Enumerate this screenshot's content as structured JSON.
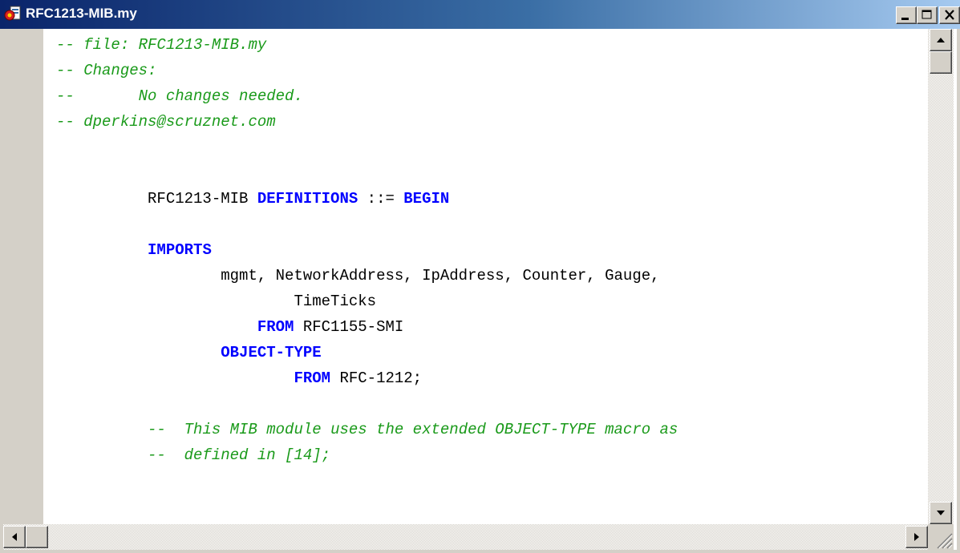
{
  "window": {
    "title": "RFC1213-MIB.my",
    "icon": "document-app-icon",
    "controls": [
      "minimize-icon",
      "maximize-icon",
      "close-icon"
    ]
  },
  "colors": {
    "comment": "#1a9a1a",
    "keyword": "#0000ff",
    "plain": "#000000",
    "titlebar_start": "#0a246a",
    "titlebar_end": "#a6caf0"
  },
  "editor": {
    "lines": [
      {
        "tokens": [
          {
            "type": "comment",
            "text": "-- file: RFC1213-MIB.my"
          }
        ]
      },
      {
        "tokens": [
          {
            "type": "comment",
            "text": "-- Changes:"
          }
        ]
      },
      {
        "tokens": [
          {
            "type": "comment",
            "text": "--       No changes needed."
          }
        ]
      },
      {
        "tokens": [
          {
            "type": "comment",
            "text": "-- dperkins@scruznet.com"
          }
        ]
      },
      {
        "tokens": []
      },
      {
        "tokens": []
      },
      {
        "tokens": [
          {
            "type": "plain",
            "text": "          RFC1213-MIB "
          },
          {
            "type": "keyword",
            "text": "DEFINITIONS"
          },
          {
            "type": "plain",
            "text": " ::= "
          },
          {
            "type": "keyword",
            "text": "BEGIN"
          }
        ]
      },
      {
        "tokens": []
      },
      {
        "tokens": [
          {
            "type": "plain",
            "text": "          "
          },
          {
            "type": "keyword",
            "text": "IMPORTS"
          }
        ]
      },
      {
        "tokens": [
          {
            "type": "plain",
            "text": "                  mgmt, NetworkAddress, IpAddress, Counter, Gauge,"
          }
        ]
      },
      {
        "tokens": [
          {
            "type": "plain",
            "text": "                          TimeTicks"
          }
        ]
      },
      {
        "tokens": [
          {
            "type": "plain",
            "text": "                      "
          },
          {
            "type": "keyword",
            "text": "FROM"
          },
          {
            "type": "plain",
            "text": " RFC1155-SMI"
          }
        ]
      },
      {
        "tokens": [
          {
            "type": "plain",
            "text": "                  "
          },
          {
            "type": "keyword",
            "text": "OBJECT-TYPE"
          }
        ]
      },
      {
        "tokens": [
          {
            "type": "plain",
            "text": "                          "
          },
          {
            "type": "keyword",
            "text": "FROM"
          },
          {
            "type": "plain",
            "text": " RFC-1212;"
          }
        ]
      },
      {
        "tokens": []
      },
      {
        "tokens": [
          {
            "type": "plain",
            "text": "          "
          },
          {
            "type": "comment",
            "text": "--  This MIB module uses the extended OBJECT-TYPE macro as"
          }
        ]
      },
      {
        "tokens": [
          {
            "type": "plain",
            "text": "          "
          },
          {
            "type": "comment",
            "text": "--  defined in [14];"
          }
        ]
      }
    ]
  },
  "scrollbars": {
    "vertical": {
      "position": 0.0,
      "icons": [
        "arrow-up-icon",
        "arrow-down-icon"
      ]
    },
    "horizontal": {
      "position": 0.0,
      "icons": [
        "arrow-left-icon",
        "arrow-right-icon"
      ]
    }
  }
}
